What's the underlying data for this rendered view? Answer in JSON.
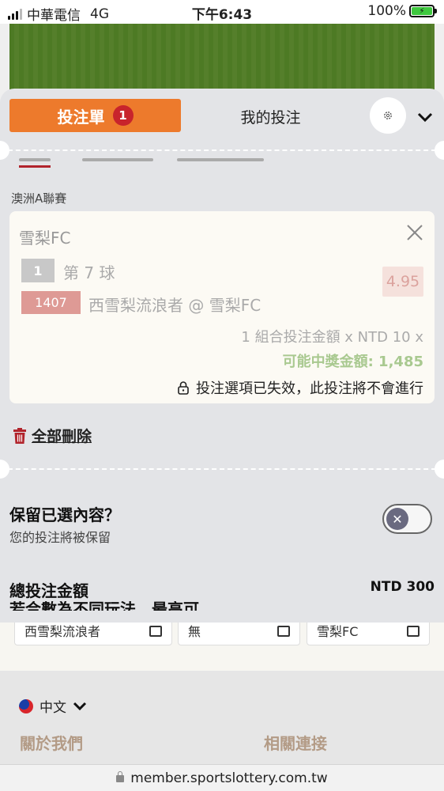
{
  "status_bar": {
    "carrier": "中華電信",
    "network": "4G",
    "time": "下午6:43",
    "battery": "100%"
  },
  "bet_slip": {
    "tab_active_label": "投注單",
    "tab_badge_count": "1",
    "tab_my_bets_label": "我的投注",
    "settings_icon": "gear-icon",
    "collapse_icon": "chevron-down-icon",
    "league": "澳洲A聯賽",
    "bet": {
      "team": "雪梨FC",
      "market_number": "1",
      "market_name": "第 7 球",
      "odds": "4.95",
      "selection_code": "1407",
      "selection_name": "西雪梨流浪者 @ 雪梨FC",
      "combo_text": "1 組合投注金額 x NTD 10 x",
      "payout_text": "可能中獎金額: 1,485",
      "invalid_notice": "投注選項已失效，此投注將不會進行"
    },
    "delete_all_label": "全部刪除",
    "keep_selection": {
      "title": "保留已選內容？",
      "subtitle": "您的投注將被保留",
      "toggle_on": false
    },
    "total_label": "總投注金額",
    "total_value": "NTD 300",
    "cut_line": "若合數為不同玩法，最高可"
  },
  "background": {
    "selects": [
      "西雪梨流浪者",
      "無",
      "雪梨FC"
    ],
    "language": "中文",
    "footer_links": [
      "關於我們",
      "相關連接"
    ]
  },
  "browser": {
    "url": "member.sportslottery.com.tw"
  },
  "colors": {
    "accent_orange": "#ed7a2c",
    "badge_red": "#c8242c",
    "payout_green": "#a9c990",
    "odds_bg": "#f5e1dc"
  }
}
